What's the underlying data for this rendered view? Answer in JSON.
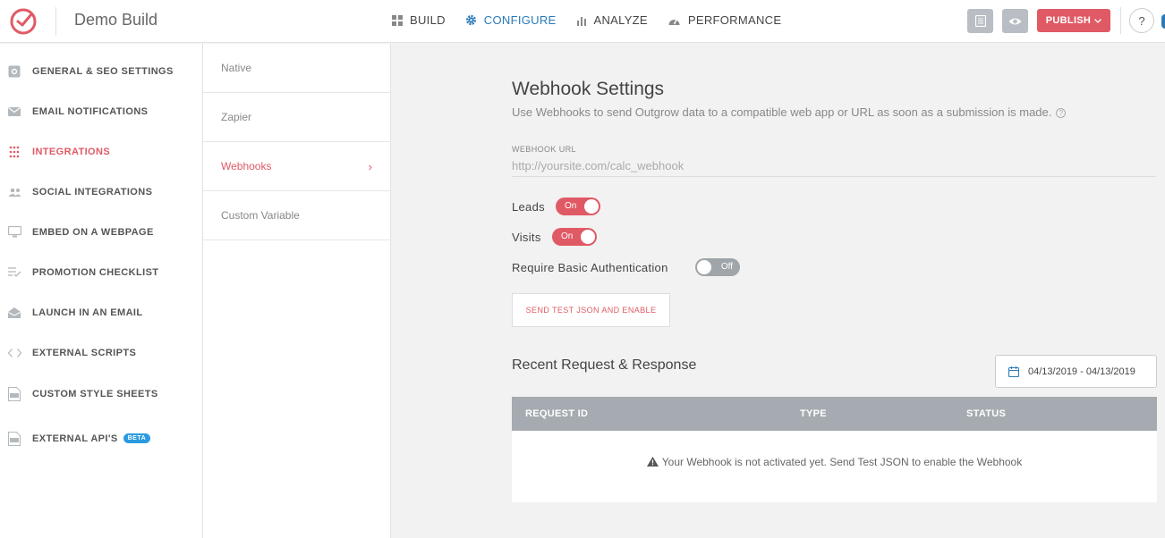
{
  "header": {
    "app_title": "Demo Build",
    "nav": [
      {
        "label": "BUILD",
        "icon": "grid-icon"
      },
      {
        "label": "CONFIGURE",
        "icon": "gear-icon"
      },
      {
        "label": "ANALYZE",
        "icon": "bar-chart-icon"
      },
      {
        "label": "PERFORMANCE",
        "icon": "speedometer-icon"
      }
    ],
    "active_nav": "CONFIGURE",
    "publish_label": "PUBLISH",
    "help_label": "?"
  },
  "sidebar": {
    "items": [
      {
        "label": "GENERAL & SEO SETTINGS",
        "icon": "settings-box-icon"
      },
      {
        "label": "EMAIL NOTIFICATIONS",
        "icon": "envelope-icon"
      },
      {
        "label": "INTEGRATIONS",
        "icon": "dot-grid-icon"
      },
      {
        "label": "SOCIAL INTEGRATIONS",
        "icon": "people-icon"
      },
      {
        "label": "EMBED ON A WEBPAGE",
        "icon": "monitor-icon"
      },
      {
        "label": "PROMOTION CHECKLIST",
        "icon": "checklist-icon"
      },
      {
        "label": "LAUNCH IN AN EMAIL",
        "icon": "open-envelope-icon"
      },
      {
        "label": "EXTERNAL SCRIPTS",
        "icon": "code-icon"
      },
      {
        "label": "CUSTOM STYLE SHEETS",
        "icon": "css-file-icon"
      },
      {
        "label": "EXTERNAL API'S",
        "icon": "api-file-icon",
        "badge": "BETA"
      }
    ],
    "active_item": "INTEGRATIONS"
  },
  "subnav": {
    "items": [
      "Native",
      "Zapier",
      "Webhooks",
      "Custom Variable"
    ],
    "active": "Webhooks",
    "chevron": "›"
  },
  "webhook": {
    "title": "Webhook Settings",
    "description": "Use Webhooks to send Outgrow data to a compatible web app or URL as soon as a submission is made.",
    "info_glyph": "?",
    "url_label": "WEBHOOK URL",
    "url_placeholder": "http://yoursite.com/calc_webhook",
    "toggles": [
      {
        "label": "Leads",
        "state": "On"
      },
      {
        "label": "Visits",
        "state": "On"
      },
      {
        "label": "Require Basic Authentication",
        "state": "Off"
      }
    ],
    "send_button": "SEND TEST JSON AND ENABLE"
  },
  "recent": {
    "title": "Recent Request & Response",
    "date_range": "04/13/2019 - 04/13/2019",
    "columns": [
      "REQUEST ID",
      "TYPE",
      "STATUS"
    ],
    "empty_message": "Your Webhook is not activated yet. Send Test JSON to enable the Webhook"
  },
  "colors": {
    "accent": "#e05a65",
    "configure_blue": "#2b7bb9",
    "table_header": "#a5abb0"
  }
}
